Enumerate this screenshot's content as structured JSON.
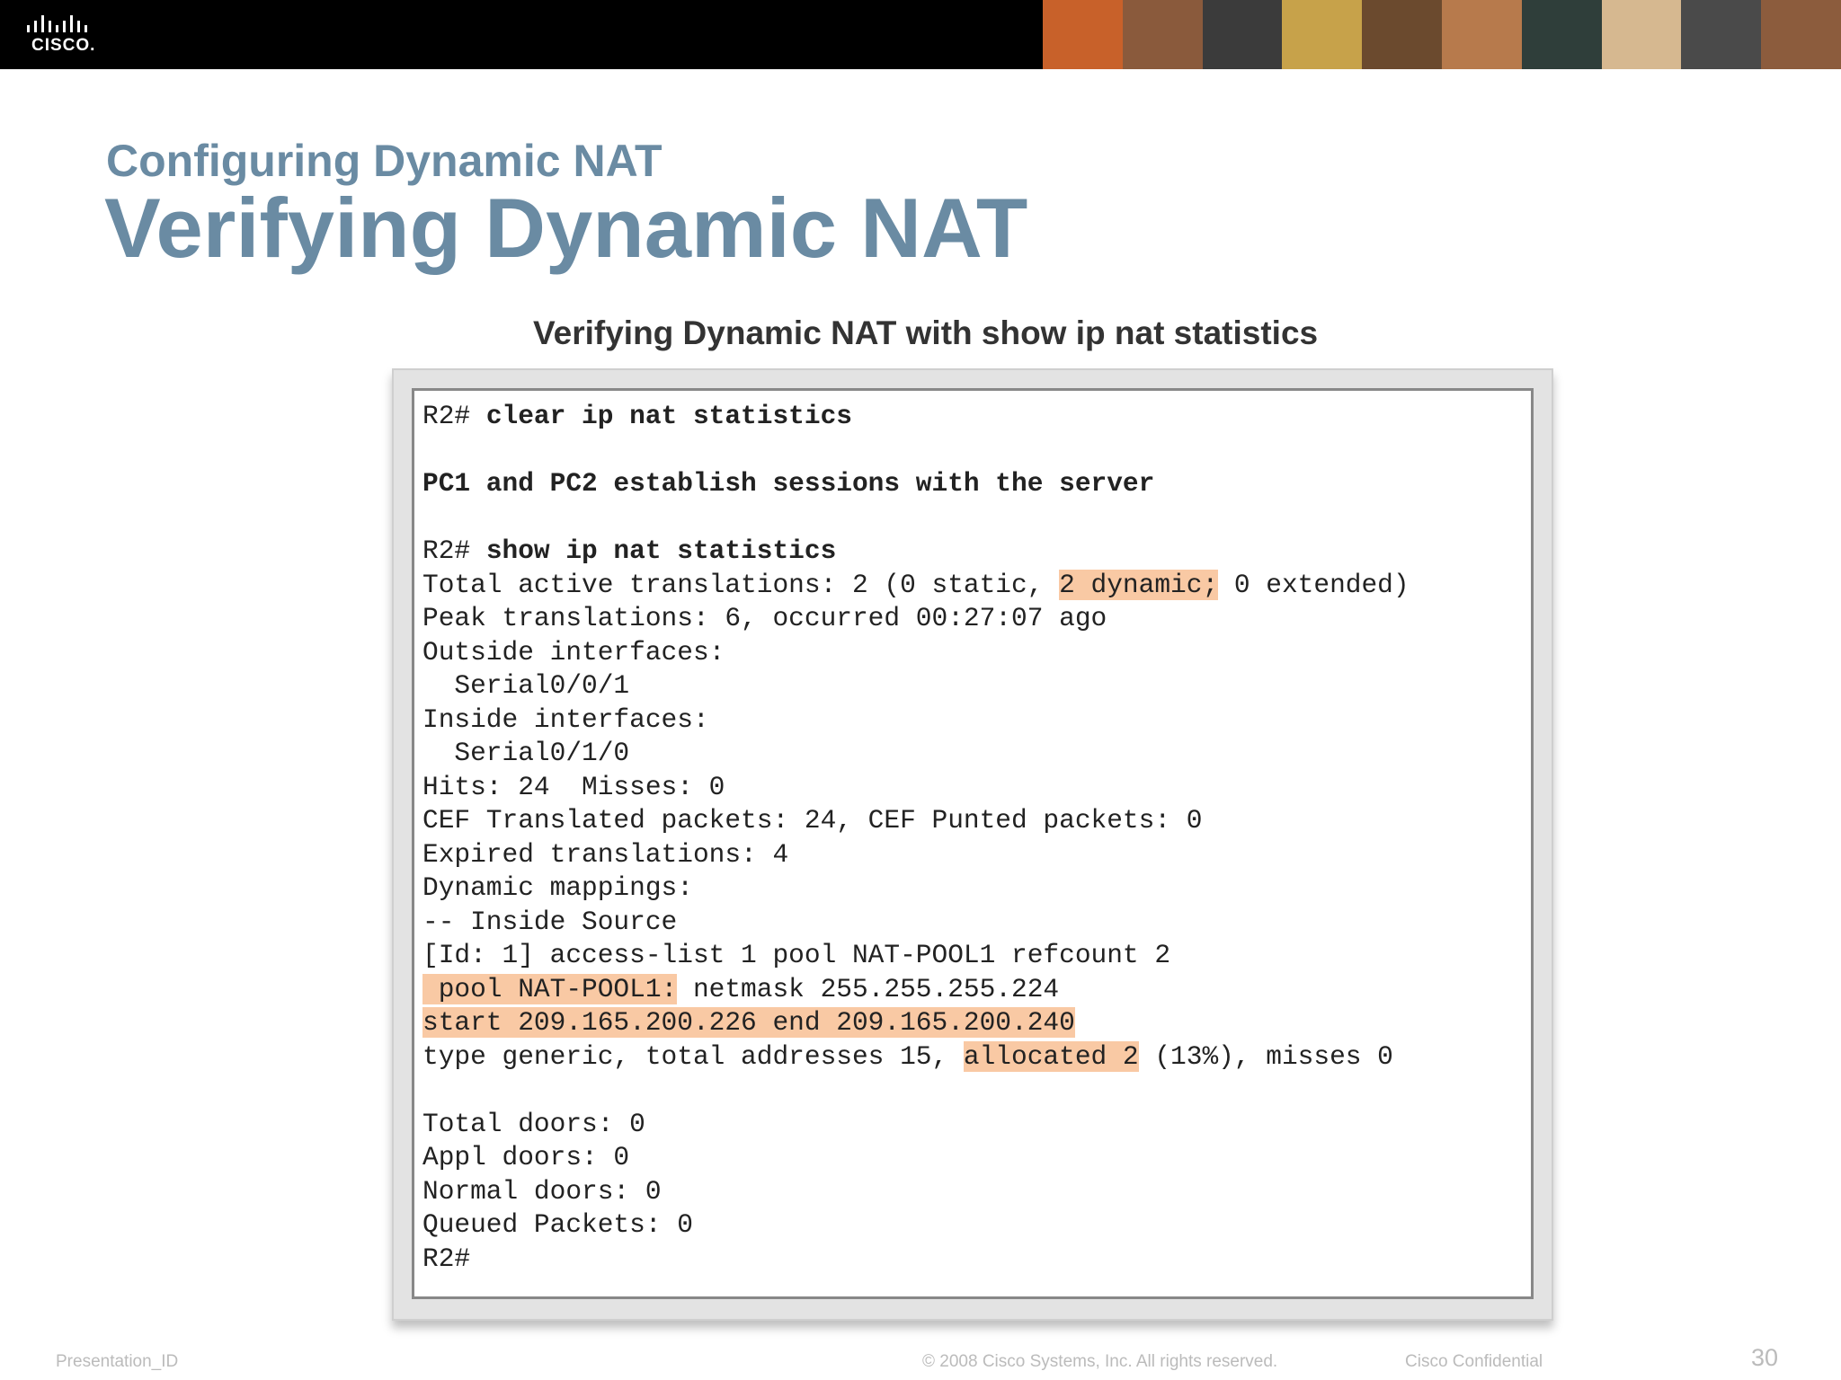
{
  "header": {
    "logo_text": "CISCO.",
    "banner_colors": [
      "#C8612A",
      "#8A5A3C",
      "#3B3B3B",
      "#C7A24A",
      "#6B4A2E",
      "#B77A4C",
      "#2F3E3A",
      "#D6B890",
      "#4A4A4A",
      "#8C5C3D"
    ]
  },
  "slide": {
    "section_title": "Configuring Dynamic NAT",
    "title": "Verifying Dynamic NAT",
    "figure_caption": "Verifying Dynamic NAT with show ip nat statistics"
  },
  "terminal": {
    "highlight_color": "#F9C9A4",
    "lines": [
      {
        "segments": [
          {
            "text": "R2# "
          },
          {
            "text": "clear ip nat statistics",
            "bold": true
          }
        ]
      },
      {
        "segments": []
      },
      {
        "segments": [
          {
            "text": "PC1 and PC2 establish sessions with the server",
            "bold": true
          }
        ]
      },
      {
        "segments": []
      },
      {
        "segments": [
          {
            "text": "R2# "
          },
          {
            "text": "show ip nat statistics",
            "bold": true
          }
        ]
      },
      {
        "segments": [
          {
            "text": "Total active translations: 2 (0 static, "
          },
          {
            "text": "2 dynamic;",
            "hl": true
          },
          {
            "text": " 0 extended)"
          }
        ]
      },
      {
        "segments": [
          {
            "text": "Peak translations: 6, occurred 00:27:07 ago"
          }
        ]
      },
      {
        "segments": [
          {
            "text": "Outside interfaces:"
          }
        ]
      },
      {
        "segments": [
          {
            "text": "  Serial0/0/1"
          }
        ]
      },
      {
        "segments": [
          {
            "text": "Inside interfaces:"
          }
        ]
      },
      {
        "segments": [
          {
            "text": "  Serial0/1/0"
          }
        ]
      },
      {
        "segments": [
          {
            "text": "Hits: 24  Misses: 0"
          }
        ]
      },
      {
        "segments": [
          {
            "text": "CEF Translated packets: 24, CEF Punted packets: 0"
          }
        ]
      },
      {
        "segments": [
          {
            "text": "Expired translations: 4"
          }
        ]
      },
      {
        "segments": [
          {
            "text": "Dynamic mappings:"
          }
        ]
      },
      {
        "segments": [
          {
            "text": "-- Inside Source"
          }
        ]
      },
      {
        "segments": [
          {
            "text": "[Id: 1] access-list 1 pool NAT-POOL1 refcount 2"
          }
        ]
      },
      {
        "segments": [
          {
            "text": " pool NAT-POOL1:",
            "hl": true
          },
          {
            "text": " netmask 255.255.255.224"
          }
        ]
      },
      {
        "segments": [
          {
            "text": "start 209.165.200.226 end 209.165.200.240",
            "hl": true
          }
        ]
      },
      {
        "segments": [
          {
            "text": "type generic, total addresses 15, "
          },
          {
            "text": "allocated 2",
            "hl": true
          },
          {
            "text": " (13%), misses 0"
          }
        ]
      },
      {
        "segments": []
      },
      {
        "segments": [
          {
            "text": "Total doors: 0"
          }
        ]
      },
      {
        "segments": [
          {
            "text": "Appl doors: 0"
          }
        ]
      },
      {
        "segments": [
          {
            "text": "Normal doors: 0"
          }
        ]
      },
      {
        "segments": [
          {
            "text": "Queued Packets: 0"
          }
        ]
      },
      {
        "segments": [
          {
            "text": "R2#"
          }
        ]
      }
    ]
  },
  "footer": {
    "presentation_id": "Presentation_ID",
    "copyright": "© 2008 Cisco Systems, Inc. All rights reserved.",
    "confidential": "Cisco Confidential",
    "page_number": "30"
  }
}
